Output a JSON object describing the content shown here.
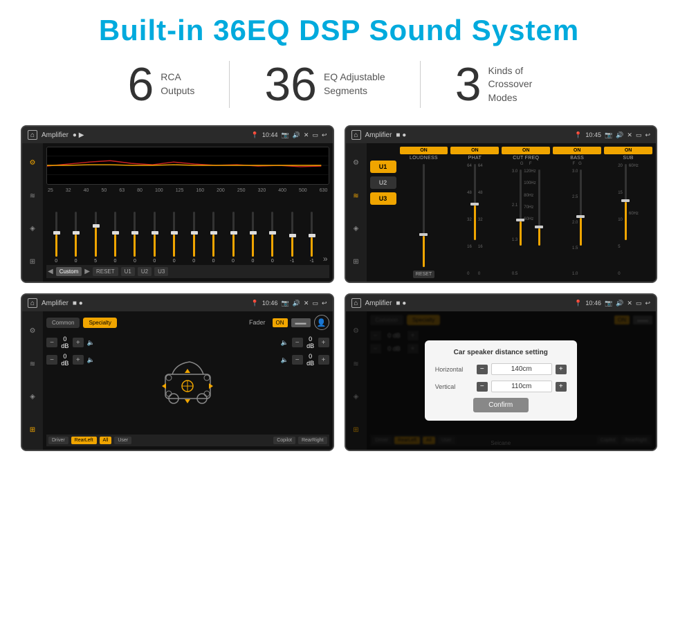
{
  "page": {
    "title": "Built-in 36EQ DSP Sound System",
    "stats": [
      {
        "number": "6",
        "text": "RCA\nOutputs"
      },
      {
        "number": "36",
        "text": "EQ Adjustable\nSegments"
      },
      {
        "number": "3",
        "text": "Kinds of\nCrossover Modes"
      }
    ],
    "screens": [
      {
        "id": "screen1",
        "label": "EQ Screen",
        "bar": {
          "title": "Amplifier",
          "time": "10:44"
        },
        "eq_freqs": [
          "25",
          "32",
          "40",
          "50",
          "63",
          "80",
          "100",
          "125",
          "160",
          "200",
          "250",
          "320",
          "400",
          "500",
          "630"
        ],
        "eq_values": [
          "0",
          "0",
          "5",
          "0",
          "0",
          "0",
          "0",
          "0",
          "0",
          "0",
          "0",
          "0",
          "-1",
          "-1"
        ],
        "buttons": [
          "Custom",
          "RESET",
          "U1",
          "U2",
          "U3"
        ]
      },
      {
        "id": "screen2",
        "label": "Amplifier Channel Screen",
        "bar": {
          "title": "Amplifier",
          "time": "10:45"
        },
        "u_labels": [
          "U1",
          "U2",
          "U3"
        ],
        "channels": [
          "LOUDNESS",
          "PHAT",
          "CUT FREQ",
          "BASS",
          "SUB"
        ],
        "reset": "RESET"
      },
      {
        "id": "screen3",
        "label": "Fader Screen",
        "bar": {
          "title": "Amplifier",
          "time": "10:46"
        },
        "tabs": [
          "Common",
          "Specialty"
        ],
        "fader_label": "Fader",
        "fader_on": "ON",
        "db_values": [
          "0 dB",
          "0 dB",
          "0 dB",
          "0 dB"
        ],
        "bottom_buttons": [
          "Driver",
          "RearLeft",
          "All",
          "User",
          "Copilot",
          "RearRight"
        ]
      },
      {
        "id": "screen4",
        "label": "Speaker Distance Screen",
        "bar": {
          "title": "Amplifier",
          "time": "10:46"
        },
        "tabs": [
          "Common",
          "Specialty"
        ],
        "fader_on": "ON",
        "dialog": {
          "title": "Car speaker distance setting",
          "horizontal_label": "Horizontal",
          "horizontal_value": "140cm",
          "vertical_label": "Vertical",
          "vertical_value": "110cm",
          "confirm_label": "Confirm"
        },
        "db_values": [
          "0 dB",
          "0 dB"
        ],
        "bottom_buttons": [
          "Driver",
          "RearLeft",
          "All",
          "User",
          "Copilot",
          "RearRight"
        ]
      }
    ]
  }
}
